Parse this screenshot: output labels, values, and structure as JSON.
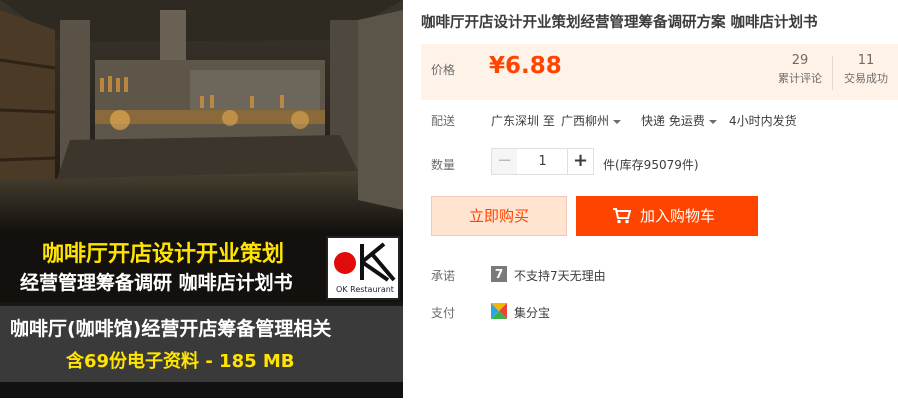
{
  "image": {
    "banner_line1": "咖啡厅开店设计开业策划",
    "banner_line2": "经营管理筹备调研 咖啡店计划书",
    "banner_line3": "咖啡厅(咖啡馆)经营开店筹备管理相关",
    "banner_line4": "含69份电子资料 -   185  MB",
    "logo_text": "OK Restaurant",
    "logo_dot_color": "#e00b0b",
    "yellow_text_color": "#ffe400"
  },
  "product": {
    "title": "咖啡厅开店设计开业策划经营管理筹备调研方案 咖啡店计划书"
  },
  "price": {
    "label": "价格",
    "value": "¥6.88",
    "color": "#ff4400"
  },
  "stats": {
    "reviews_count": "29",
    "reviews_label": "累计评论",
    "sales_count": "11",
    "sales_label": "交易成功"
  },
  "shipping": {
    "label": "配送",
    "from": "广东深圳 至",
    "to": "广西柳州",
    "method": "快递 免运费",
    "dispatch": "4小时内发货"
  },
  "quantity": {
    "label": "数量",
    "minus": "−",
    "value": "1",
    "plus": "+",
    "stock_text": "件(库存95079件)"
  },
  "actions": {
    "buy_now": "立即购买",
    "add_to_cart": "加入购物车"
  },
  "promise": {
    "label": "承诺",
    "icon_glyph": "7",
    "icon": "seven-day-return-icon",
    "text": "不支持7天无理由"
  },
  "payment": {
    "label": "支付",
    "icon": "jifenbao-icon",
    "text": "集分宝"
  }
}
